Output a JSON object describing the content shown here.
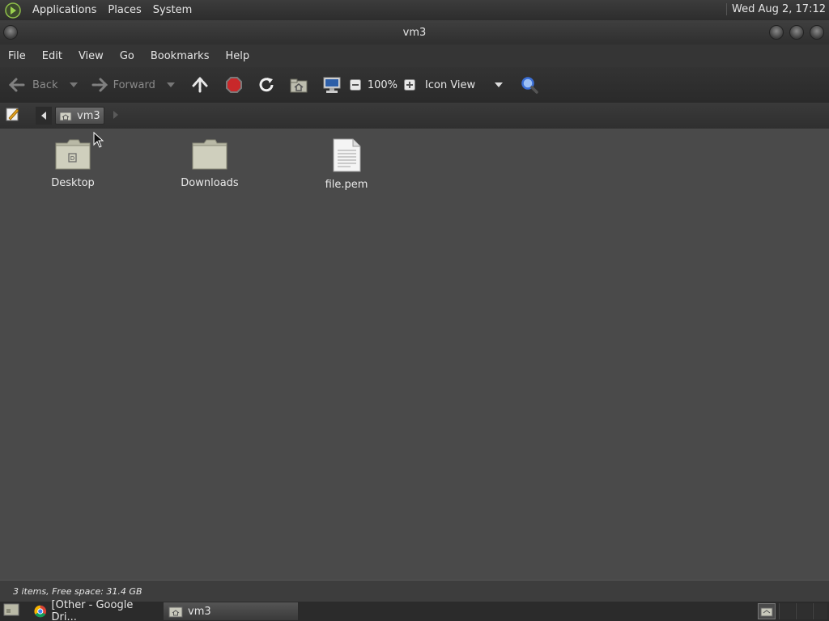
{
  "top_panel": {
    "menus": [
      "Applications",
      "Places",
      "System"
    ],
    "clock": "Wed Aug  2, 17:12"
  },
  "window": {
    "title": "vm3"
  },
  "menubar": {
    "items": [
      "File",
      "Edit",
      "View",
      "Go",
      "Bookmarks",
      "Help"
    ]
  },
  "toolbar": {
    "back_label": "Back",
    "forward_label": "Forward",
    "zoom_level": "100%",
    "view_mode": "Icon View"
  },
  "location": {
    "current_folder": "vm3"
  },
  "files": [
    {
      "name": "Desktop",
      "type": "folder-desktop"
    },
    {
      "name": "Downloads",
      "type": "folder"
    },
    {
      "name": "file.pem",
      "type": "document"
    }
  ],
  "status": {
    "text": "3 items, Free space: 31.4 GB"
  },
  "taskbar": {
    "tasks": [
      {
        "label": "[Other - Google Dri...",
        "icon": "chrome-icon",
        "active": false
      },
      {
        "label": "vm3",
        "icon": "home-folder-icon",
        "active": true
      }
    ]
  },
  "colors": {
    "background": "#4a4a4a",
    "stop_red": "#c8282a",
    "search_blue": "#3b6fd6"
  }
}
